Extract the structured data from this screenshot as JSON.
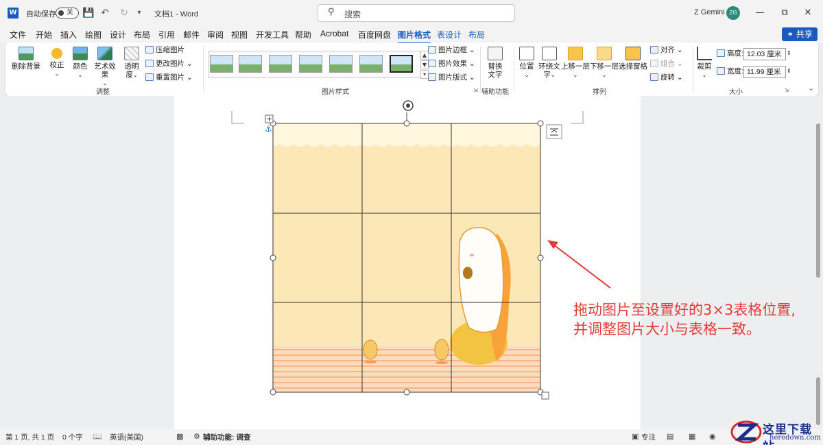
{
  "titlebar": {
    "autosave_label": "自动保存",
    "autosave_state": "关",
    "doc_title": "文档1  -  Word",
    "search_placeholder": "搜索",
    "user_name": "Z Gemini",
    "user_initials": "ZG"
  },
  "tabs": [
    {
      "label": "文件"
    },
    {
      "label": "开始"
    },
    {
      "label": "插入"
    },
    {
      "label": "绘图"
    },
    {
      "label": "设计"
    },
    {
      "label": "布局"
    },
    {
      "label": "引用"
    },
    {
      "label": "邮件"
    },
    {
      "label": "审阅"
    },
    {
      "label": "视图"
    },
    {
      "label": "开发工具"
    },
    {
      "label": "帮助"
    },
    {
      "label": "Acrobat"
    },
    {
      "label": "百度网盘"
    },
    {
      "label": "图片格式"
    },
    {
      "label": "表设计"
    },
    {
      "label": "布局"
    }
  ],
  "share_label": "共享",
  "ribbon": {
    "remove_bg": "删除背景",
    "corrections": "校正",
    "color": "颜色",
    "artistic": "艺术效果",
    "transparency_1": "透明",
    "transparency_2": "度",
    "compress": "压缩图片",
    "change": "更改图片",
    "reset": "重置图片",
    "group_adjust": "调整",
    "group_styles": "图片样式",
    "border": "图片边框",
    "effects": "图片效果",
    "layout": "图片版式",
    "alt_text_1": "替换",
    "alt_text_2": "文字",
    "group_access": "辅助功能",
    "position": "位置",
    "wrap_1": "环绕文",
    "wrap_2": "字",
    "forward": "上移一层",
    "backward": "下移一层",
    "selection": "选择窗格",
    "align": "对齐",
    "group_obj": "组合",
    "rotate": "旋转",
    "group_arrange": "排列",
    "crop": "裁剪",
    "height_label": "高度:",
    "height_value": "12.03 厘米",
    "width_label": "宽度:",
    "width_value": "11.99 厘米",
    "group_size": "大小"
  },
  "status": {
    "page": "第 1 页, 共 1 页",
    "words": "0 个字",
    "language": "英语(美国)",
    "accessibility": "辅助功能: 调查",
    "focus": "专注"
  },
  "annotation": {
    "line1": "拖动图片至设置好的3×3表格位置,",
    "line2": "并调整图片大小与表格一致。"
  },
  "watermark": {
    "name": "这里下载站",
    "domain": "heredown.com"
  },
  "colors": {
    "accent": "#185abd",
    "annotation": "#e13b3b",
    "watermark": "#1a2f8c"
  }
}
